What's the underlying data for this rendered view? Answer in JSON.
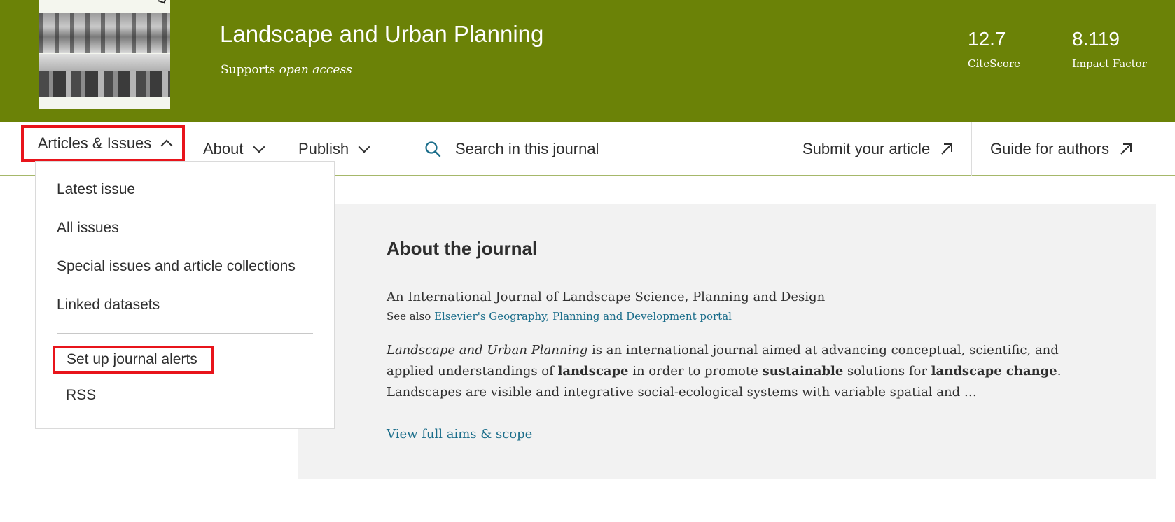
{
  "journal": {
    "title": "Landscape and Urban Planning",
    "subtitle_prefix": "Supports",
    "subtitle_em": "open access",
    "metrics": [
      {
        "value": "12.7",
        "label": "CiteScore"
      },
      {
        "value": "8.119",
        "label": "Impact Factor"
      }
    ]
  },
  "nav": {
    "articles_label": "Articles & Issues",
    "about_label": "About",
    "publish_label": "Publish",
    "search_placeholder": "Search in this journal",
    "submit_label": "Submit your article",
    "guide_label": "Guide for authors"
  },
  "dropdown": {
    "items": [
      "Latest issue",
      "All issues",
      "Special issues and article collections",
      "Linked datasets"
    ],
    "alerts_label": "Set up journal alerts",
    "rss_label": "RSS"
  },
  "about": {
    "heading": "About the journal",
    "tagline": "An International Journal of Landscape Science, Planning and Design",
    "see_also_prefix": "See also",
    "see_also_link": "Elsevier's Geography, Planning and Development portal",
    "desc_journal": "Landscape and Urban Planning",
    "desc_1": " is an international journal aimed at advancing conceptual, scientific, and applied understandings of ",
    "desc_b1": "landscape",
    "desc_2": " in order to promote ",
    "desc_b2": "sustainable",
    "desc_3": " solutions for ",
    "desc_b3": "landscape change",
    "desc_4": ". Landscapes are visible and integrative social-ecological systems with variable spatial and …",
    "more_link": "View full aims & scope"
  },
  "colors": {
    "brand_green": "#6b8207",
    "highlight_red": "#e8141b",
    "link_blue": "#1a6d8a"
  }
}
